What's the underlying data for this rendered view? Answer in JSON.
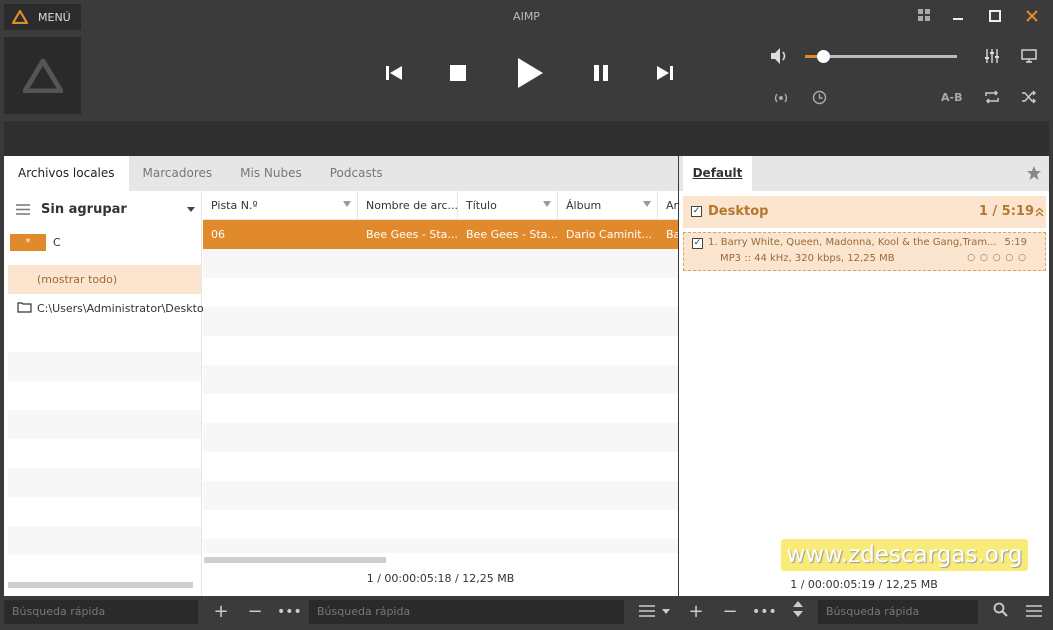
{
  "window": {
    "title": "AIMP",
    "menu_label": "MENÚ"
  },
  "colors": {
    "accent": "#e08a2c",
    "dark": "#3b3b3b",
    "selected_row": "#e08a2c",
    "playlist_highlight": "#fbe5cf"
  },
  "player": {
    "volume_fraction": 0.12,
    "ab_label": "A-B"
  },
  "library": {
    "tabs": [
      {
        "label": "Archivos locales"
      },
      {
        "label": "Marcadores"
      },
      {
        "label": "Mis Nubes"
      },
      {
        "label": "Podcasts"
      }
    ],
    "group_by_label": "Sin agrupar",
    "filter_chip": "*",
    "filter_letter": "C",
    "show_all_label": "(mostrar todo)",
    "folder_path": "C:\\Users\\Administrator\\Desktop",
    "columns": [
      {
        "label": "Pista N.º"
      },
      {
        "label": "Nombre de arc..."
      },
      {
        "label": "Título"
      },
      {
        "label": "Álbum"
      },
      {
        "label": "Ar"
      }
    ],
    "rows": [
      {
        "cells": [
          "06",
          "Bee Gees - Sta...",
          "Bee Gees - Sta...",
          "Dario Caminit...",
          "Ba"
        ]
      }
    ],
    "status": "1 / 00:00:05:18 / 12,25 MB"
  },
  "playlist": {
    "tab_label": "Default",
    "group_name": "Desktop",
    "group_summary": "1 / 5:19",
    "track_title": "1. Barry White, Queen, Madonna, Kool & the Gang,Tram...",
    "track_duration": "5:19",
    "track_info": "MP3 :: 44 kHz, 320 kbps, 12,25 MB",
    "rating_dots": "○ ○ ○ ○ ○",
    "status": "1 / 00:00:05:19 / 12,25 MB"
  },
  "bottom": {
    "search_placeholder_1": "Búsqueda rápida",
    "search_placeholder_2": "Búsqueda rápida",
    "search_placeholder_3": "Búsqueda rápida"
  },
  "watermark": "www.zdescargas.org"
}
